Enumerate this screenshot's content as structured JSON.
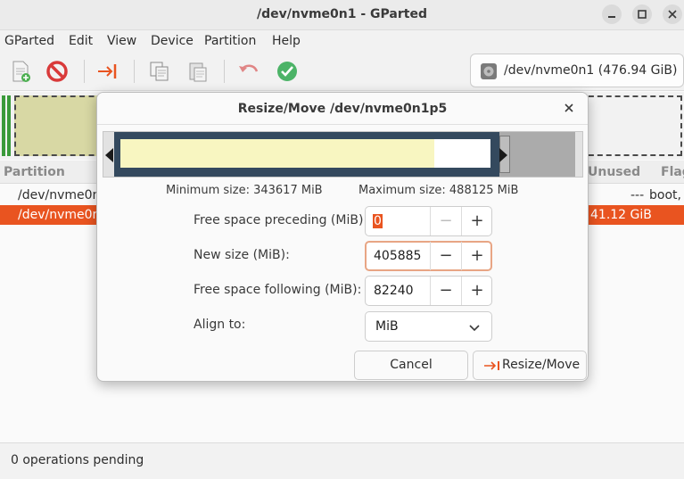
{
  "window": {
    "title": "/dev/nvme0n1 - GParted"
  },
  "menu": [
    "GParted",
    "Edit",
    "View",
    "Device",
    "Partition",
    "Help"
  ],
  "device_selector": {
    "label": "/dev/nvme0n1 (476.94 GiB)"
  },
  "partition_list": {
    "headers": {
      "partition": "Partition",
      "unused": "Unused",
      "flags": "Flag"
    },
    "rows": [
      {
        "partition": "/dev/nvme0n",
        "unused": "---",
        "flags": "boot, "
      },
      {
        "partition": "/dev/nvme0n",
        "unused": "41.12 GiB",
        "flags": "",
        "selected": true
      }
    ]
  },
  "status": {
    "text": "0 operations pending"
  },
  "dialog": {
    "title": "Resize/Move /dev/nvme0n1p5",
    "min_size": "Minimum size: 343617 MiB",
    "max_size": "Maximum size: 488125 MiB",
    "fields": {
      "preceding": {
        "label": "Free space preceding (MiB):",
        "value": "0"
      },
      "new_size": {
        "label": "New size (MiB):",
        "value": "405885"
      },
      "following": {
        "label": "Free space following (MiB):",
        "value": "82240"
      },
      "align": {
        "label": "Align to:",
        "value": "MiB"
      }
    },
    "buttons": {
      "cancel": "Cancel",
      "resize": "Resize/Move"
    }
  },
  "colors": {
    "accent": "#e95420",
    "partition_border": "#34495e",
    "used_space": "#f8f6c1",
    "stop_icon": "#d93a3a",
    "apply_icon": "#2fa84f"
  }
}
